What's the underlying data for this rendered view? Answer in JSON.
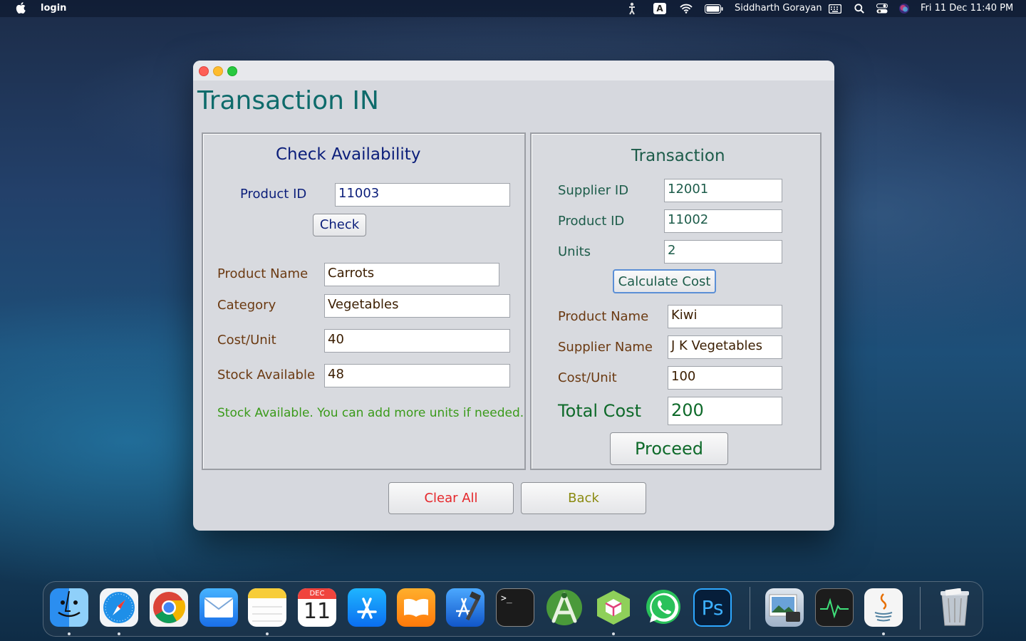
{
  "menubar": {
    "app_name": "login",
    "input_indicator": "A",
    "user_name": "Siddharth Gorayan",
    "datetime": "Fri 11 Dec  11:40 PM"
  },
  "window": {
    "title": "Transaction IN",
    "check": {
      "title": "Check Availability",
      "product_id_label": "Product ID",
      "product_id_value": "11003",
      "check_button": "Check",
      "product_name_label": "Product Name",
      "product_name_value": "Carrots",
      "category_label": "Category",
      "category_value": "Vegetables",
      "cost_label": "Cost/Unit",
      "cost_value": "40",
      "stock_label": "Stock Available",
      "stock_value": "48",
      "message": "Stock Available. You can add more units if needed."
    },
    "transaction": {
      "title": "Transaction",
      "supplier_id_label": "Supplier ID",
      "supplier_id_value": "12001",
      "product_id_label": "Product ID",
      "product_id_value": "11002",
      "units_label": "Units",
      "units_value": "2",
      "calculate_button": "Calculate Cost",
      "product_name_label": "Product Name",
      "product_name_value": "Kiwi",
      "supplier_name_label": "Supplier Name",
      "supplier_name_value": "J K Vegetables",
      "cost_label": "Cost/Unit",
      "cost_value": "100",
      "total_label": "Total Cost",
      "total_value": "200",
      "proceed_button": "Proceed"
    },
    "clear_button": "Clear All",
    "back_button": "Back"
  },
  "dock": {
    "calendar_month": "DEC",
    "calendar_day": "11",
    "terminal_prompt": ">_",
    "photoshop_label": "Ps",
    "items": [
      "finder-icon",
      "safari-icon",
      "chrome-icon",
      "mail-icon",
      "notes-icon",
      "calendar-icon",
      "app-store-icon",
      "books-icon",
      "xcode-icon",
      "terminal-icon",
      "android-studio-icon",
      "netbeans-icon",
      "whatsapp-icon",
      "photoshop-icon",
      "preview-icon",
      "activity-monitor-icon",
      "java-icon",
      "trash-icon"
    ]
  },
  "colors": {
    "title_teal": "#0e6b6b",
    "check_navy": "#0b1e7a",
    "label_brown": "#6b3a12",
    "transaction_green": "#1d5c4a",
    "success_green": "#3a9a1a",
    "clear_red": "#e5262a",
    "back_olive": "#8a8a10"
  }
}
